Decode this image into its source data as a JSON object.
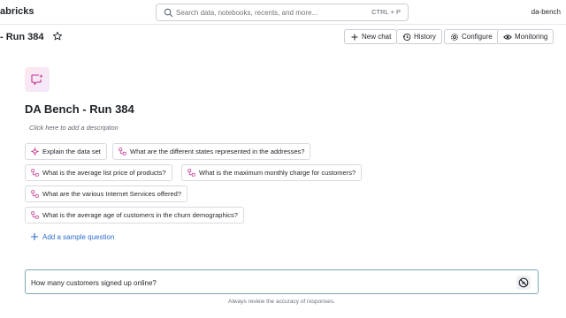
{
  "topbar": {
    "brand": "abricks",
    "search_placeholder": "Search data, notebooks, recents, and more...",
    "search_shortcut": "CTRL + P",
    "user": "da-bench"
  },
  "subbar": {
    "title": "- Run 384",
    "buttons": {
      "new_chat": "New chat",
      "history": "History",
      "configure": "Configure",
      "monitoring": "Monitoring"
    }
  },
  "space": {
    "title": "DA Bench - Run 384",
    "description": "Click here to add a description"
  },
  "samples": [
    "Explain the data set",
    "What are the different states represented in the addresses?",
    "What is the average list price of products?",
    "What is the maximum monthly charge for customers?",
    "What are the various Internet Services offered?",
    "What is the average age of customers in the churn demographics?"
  ],
  "add_sample": "Add a sample question",
  "chat": {
    "value": "How many customers signed up online?"
  },
  "disclaimer": "Always review the accuracy of responses.",
  "colors": {
    "link": "#2b6bcf",
    "sparkle": "#c2338f",
    "chat_border": "#7fa8b9"
  }
}
